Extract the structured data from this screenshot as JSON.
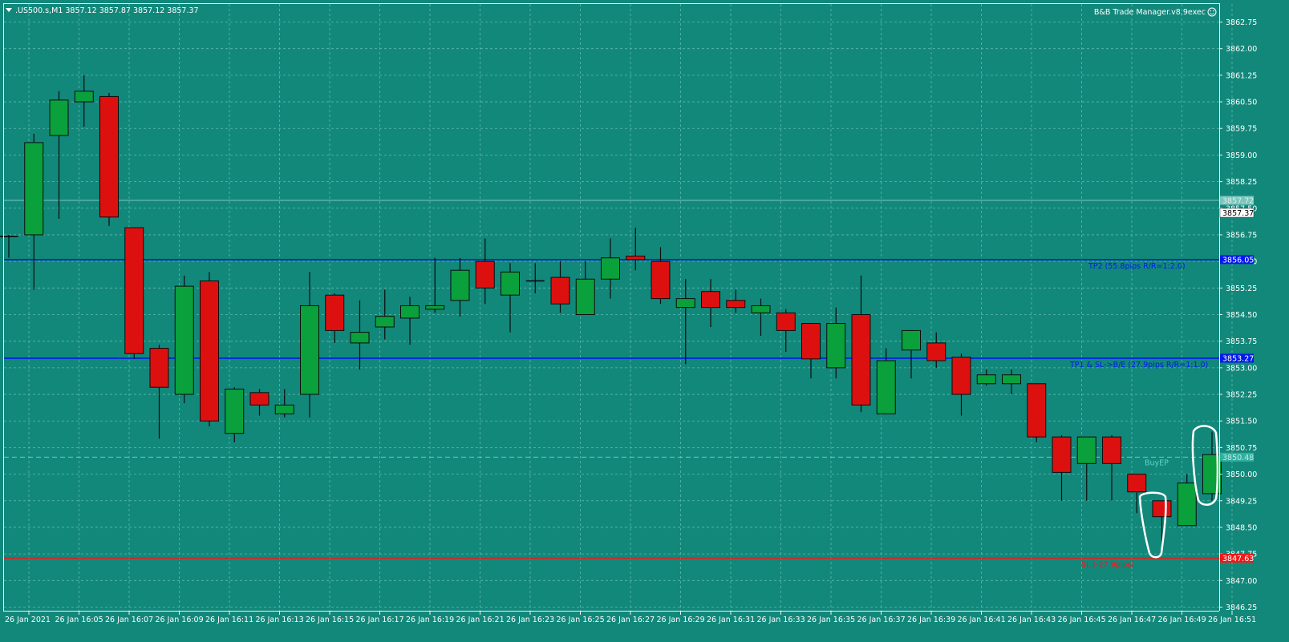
{
  "window": {
    "title": ".US500.s,M1  3857.12 3857.87 3857.12 3857.37",
    "indicator": "B&B Trade Manager.v8.9exec"
  },
  "colors": {
    "background": "#12887b",
    "grid": "#5fb8ac",
    "bull": "#0aa03c",
    "bear": "#dd1010",
    "wick": "#0c0c0c",
    "tp_line": "#0018ee",
    "sl_line": "#ee1a1a",
    "buyep_line": "#5ed4c4",
    "annotation": "#ffffff"
  },
  "icons": {
    "menu": "triangle-down-icon",
    "indicator": "smiley-icon"
  },
  "chart_data": {
    "type": "candlestick",
    "symbol": ".US500.s",
    "timeframe": "M1",
    "y_axis_labels": [
      "3862.75",
      "3862.00",
      "3861.25",
      "3860.50",
      "3859.75",
      "3859.00",
      "3858.25",
      "3857.50",
      "3856.75",
      "3856.00",
      "3855.25",
      "3854.50",
      "3853.75",
      "3853.00",
      "3852.25",
      "3851.50",
      "3850.75",
      "3850.00",
      "3849.25",
      "3848.50",
      "3847.75",
      "3847.00",
      "3846.25"
    ],
    "ylim": [
      3846.1,
      3863.2
    ],
    "x_axis_labels": [
      "26 Jan 2021",
      "26 Jan 16:05",
      "26 Jan 16:07",
      "26 Jan 16:09",
      "26 Jan 16:11",
      "26 Jan 16:13",
      "26 Jan 16:15",
      "26 Jan 16:17",
      "26 Jan 16:19",
      "26 Jan 16:21",
      "26 Jan 16:23",
      "26 Jan 16:25",
      "26 Jan 16:27",
      "26 Jan 16:29",
      "26 Jan 16:31",
      "26 Jan 16:33",
      "26 Jan 16:35",
      "26 Jan 16:37",
      "26 Jan 16:39",
      "26 Jan 16:41",
      "26 Jan 16:43",
      "26 Jan 16:45",
      "26 Jan 16:47",
      "26 Jan 16:49",
      "26 Jan 16:51"
    ],
    "candles": [
      {
        "o": 3856.7,
        "h": 3856.75,
        "l": 3856.1,
        "c": 3856.7
      },
      {
        "o": 3856.75,
        "h": 3859.6,
        "l": 3855.2,
        "c": 3859.35
      },
      {
        "o": 3859.55,
        "h": 3860.8,
        "l": 3857.2,
        "c": 3860.55
      },
      {
        "o": 3860.5,
        "h": 3861.25,
        "l": 3859.8,
        "c": 3860.8
      },
      {
        "o": 3860.65,
        "h": 3860.75,
        "l": 3857.0,
        "c": 3857.25
      },
      {
        "o": 3856.95,
        "h": 3856.95,
        "l": 3853.25,
        "c": 3853.4
      },
      {
        "o": 3853.55,
        "h": 3853.65,
        "l": 3851.0,
        "c": 3852.45
      },
      {
        "o": 3852.25,
        "h": 3855.6,
        "l": 3852.0,
        "c": 3855.3
      },
      {
        "o": 3855.45,
        "h": 3855.7,
        "l": 3851.35,
        "c": 3851.5
      },
      {
        "o": 3851.15,
        "h": 3852.45,
        "l": 3850.9,
        "c": 3852.4
      },
      {
        "o": 3852.3,
        "h": 3852.4,
        "l": 3851.65,
        "c": 3851.95
      },
      {
        "o": 3851.7,
        "h": 3852.4,
        "l": 3851.6,
        "c": 3851.95
      },
      {
        "o": 3852.25,
        "h": 3855.7,
        "l": 3851.6,
        "c": 3854.75
      },
      {
        "o": 3855.05,
        "h": 3855.1,
        "l": 3853.7,
        "c": 3854.05
      },
      {
        "o": 3853.7,
        "h": 3854.9,
        "l": 3852.95,
        "c": 3854.0
      },
      {
        "o": 3854.15,
        "h": 3855.2,
        "l": 3853.8,
        "c": 3854.45
      },
      {
        "o": 3854.4,
        "h": 3855.0,
        "l": 3853.65,
        "c": 3854.75
      },
      {
        "o": 3854.65,
        "h": 3856.1,
        "l": 3854.55,
        "c": 3854.75
      },
      {
        "o": 3854.9,
        "h": 3856.1,
        "l": 3854.45,
        "c": 3855.75
      },
      {
        "o": 3856.0,
        "h": 3856.65,
        "l": 3854.8,
        "c": 3855.25
      },
      {
        "o": 3855.05,
        "h": 3855.95,
        "l": 3854.0,
        "c": 3855.7
      },
      {
        "o": 3855.45,
        "h": 3855.95,
        "l": 3855.1,
        "c": 3855.45
      },
      {
        "o": 3855.55,
        "h": 3856.0,
        "l": 3854.55,
        "c": 3854.8
      },
      {
        "o": 3854.5,
        "h": 3856.0,
        "l": 3854.5,
        "c": 3855.5
      },
      {
        "o": 3855.5,
        "h": 3856.65,
        "l": 3854.95,
        "c": 3856.1
      },
      {
        "o": 3856.15,
        "h": 3856.95,
        "l": 3855.75,
        "c": 3856.05
      },
      {
        "o": 3856.0,
        "h": 3856.4,
        "l": 3854.8,
        "c": 3854.95
      },
      {
        "o": 3854.7,
        "h": 3855.5,
        "l": 3853.1,
        "c": 3854.95
      },
      {
        "o": 3855.15,
        "h": 3855.5,
        "l": 3854.15,
        "c": 3854.7
      },
      {
        "o": 3854.9,
        "h": 3855.2,
        "l": 3854.55,
        "c": 3854.7
      },
      {
        "o": 3854.55,
        "h": 3854.95,
        "l": 3853.9,
        "c": 3854.75
      },
      {
        "o": 3854.55,
        "h": 3854.65,
        "l": 3853.45,
        "c": 3854.05
      },
      {
        "o": 3854.25,
        "h": 3854.25,
        "l": 3852.7,
        "c": 3853.25
      },
      {
        "o": 3853.0,
        "h": 3854.7,
        "l": 3852.7,
        "c": 3854.25
      },
      {
        "o": 3854.5,
        "h": 3855.6,
        "l": 3851.75,
        "c": 3851.95
      },
      {
        "o": 3851.7,
        "h": 3853.55,
        "l": 3851.7,
        "c": 3853.2
      },
      {
        "o": 3853.5,
        "h": 3854.0,
        "l": 3852.7,
        "c": 3854.05
      },
      {
        "o": 3853.7,
        "h": 3854.0,
        "l": 3853.0,
        "c": 3853.2
      },
      {
        "o": 3853.3,
        "h": 3853.4,
        "l": 3851.65,
        "c": 3852.25
      },
      {
        "o": 3852.55,
        "h": 3852.95,
        "l": 3852.5,
        "c": 3852.8
      },
      {
        "o": 3852.55,
        "h": 3852.95,
        "l": 3852.25,
        "c": 3852.8
      },
      {
        "o": 3852.55,
        "h": 3852.55,
        "l": 3850.9,
        "c": 3851.05
      },
      {
        "o": 3851.05,
        "h": 3851.1,
        "l": 3849.25,
        "c": 3850.05
      },
      {
        "o": 3850.3,
        "h": 3851.05,
        "l": 3849.25,
        "c": 3851.05
      },
      {
        "o": 3851.05,
        "h": 3851.1,
        "l": 3849.25,
        "c": 3850.3
      },
      {
        "o": 3850.0,
        "h": 3850.0,
        "l": 3848.9,
        "c": 3849.5
      },
      {
        "o": 3849.25,
        "h": 3849.25,
        "l": 3847.85,
        "c": 3848.8
      },
      {
        "o": 3848.55,
        "h": 3850.0,
        "l": 3848.55,
        "c": 3849.75
      },
      {
        "o": 3849.45,
        "h": 3851.2,
        "l": 3849.25,
        "c": 3850.55
      }
    ],
    "hlines": [
      {
        "name": "tp2",
        "price": 3856.05,
        "tag": "3856.05",
        "label": "TP2 (55.8pips R/R=1:2.0)",
        "color": "#0018ee"
      },
      {
        "name": "tp1",
        "price": 3853.27,
        "tag": "3853.27",
        "label": "TP1 & SL->B/E (27.9pips R/R=1:1.0)",
        "color": "#0018ee"
      },
      {
        "name": "buy-entry",
        "price": 3850.48,
        "tag": "3850.48",
        "label": "BuyEP",
        "color": "#5ed4c4"
      },
      {
        "name": "stop-loss",
        "price": 3847.63,
        "tag": "3847.63",
        "label": "SL (-27.9pips)",
        "color": "#ee1a1a"
      },
      {
        "name": "ask",
        "price": 3857.72,
        "tag": "3857.72",
        "label": "",
        "color": "#7cc6be"
      }
    ],
    "current_price": "3857.37",
    "grid": true
  }
}
